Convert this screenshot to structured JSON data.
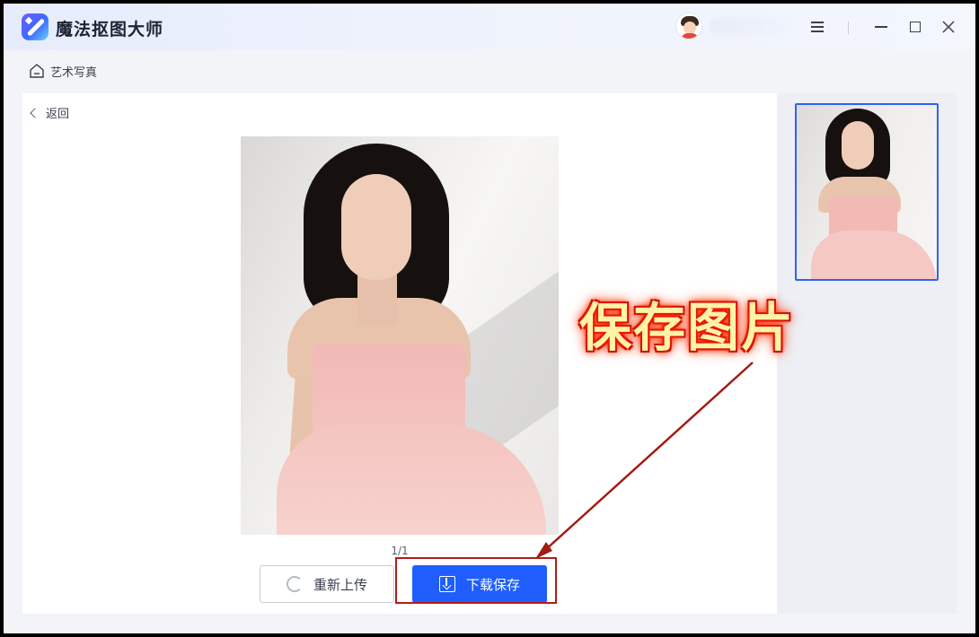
{
  "app": {
    "title": "魔法抠图大师"
  },
  "breadcrumb": {
    "label": "艺术写真"
  },
  "main": {
    "back_label": "返回",
    "pager": "1/1",
    "reupload_label": "重新上传",
    "download_label": "下载保存"
  },
  "annotation": {
    "text": "保存图片"
  },
  "icons": [
    "app-logo-icon",
    "menu-icon",
    "minimize-icon",
    "maximize-icon",
    "close-icon",
    "home-icon",
    "chevron-left-icon",
    "refresh-icon",
    "download-icon"
  ],
  "colors": {
    "primary": "#1f5efc",
    "thumb_border": "#2c62f5",
    "annotation_red": "#b01e16"
  }
}
